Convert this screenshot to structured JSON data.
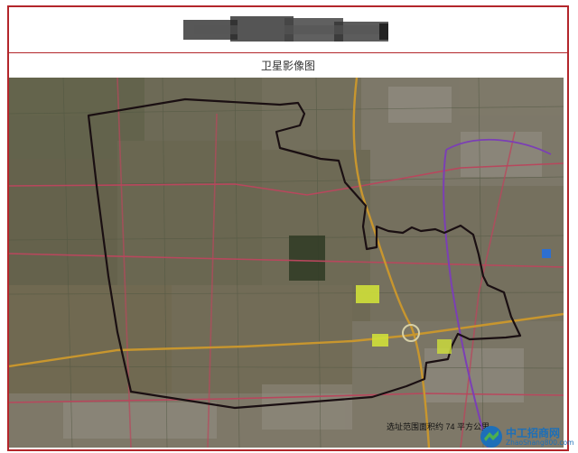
{
  "header": {
    "title_redacted": true,
    "subtitle": "卫星影像图"
  },
  "map": {
    "type": "satellite-image",
    "annotation": "选址范围面积约 74 平方公里",
    "colors": {
      "site_boundary": "#1a0f12",
      "main_highway": "#c8962e",
      "arterial_road": "#b8475d",
      "rail_line": "#7b3fb5",
      "plot_highlight": "#cfe03a"
    }
  },
  "watermark": {
    "title": "中工招商网",
    "url": "ZhaoShang800.com",
    "icon": "company-logo-icon"
  }
}
